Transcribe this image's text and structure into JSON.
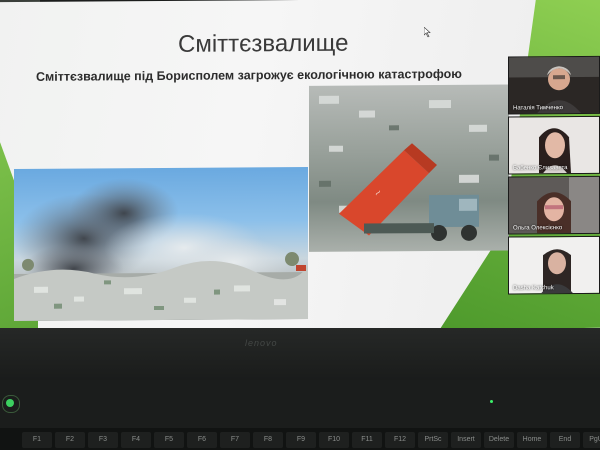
{
  "slide": {
    "title": "Сміттєзвалище",
    "subtitle": "Сміттєзвалище під Борисполем загрожує екологічною катастрофою"
  },
  "participants": [
    {
      "name": "Наталія Тимченко"
    },
    {
      "name": "Бабенко Єлизавета"
    },
    {
      "name": "Ольга Олексієнко"
    },
    {
      "name": "Dasha Katchuk"
    }
  ],
  "laptop": {
    "brand": "lenovo"
  },
  "keyboard": {
    "keys": [
      "F1",
      "F2",
      "F3",
      "F4",
      "F5",
      "F6",
      "F7",
      "F8",
      "F9",
      "F10",
      "F11",
      "F12",
      "PrtSc",
      "Insert",
      "Delete",
      "Home",
      "End",
      "PgUp"
    ]
  },
  "colors": {
    "slide_accent": "#6bb33e",
    "slide_background": "#f4f4f4"
  }
}
